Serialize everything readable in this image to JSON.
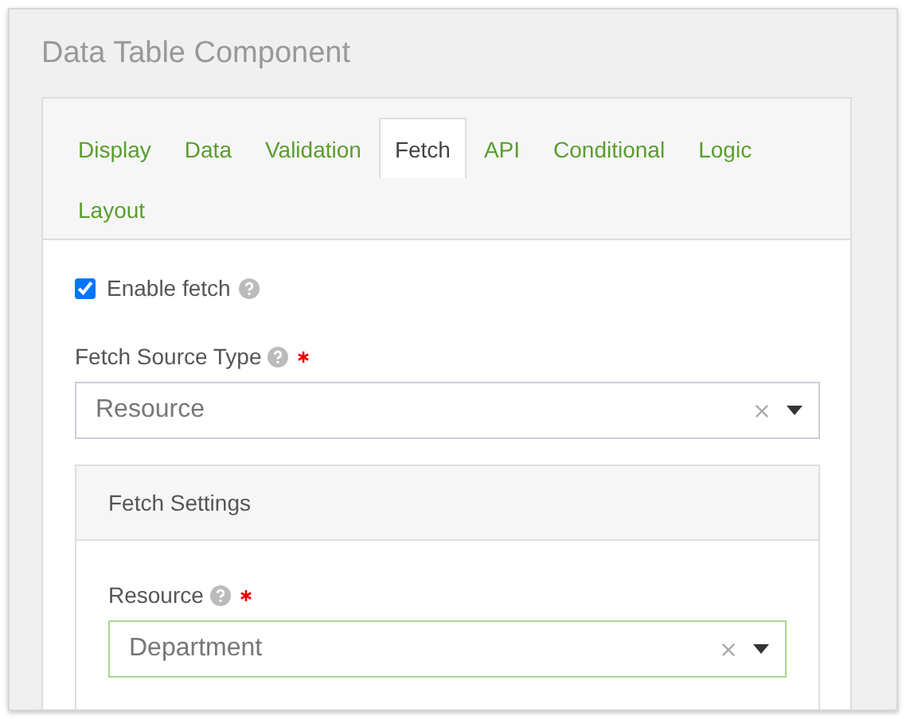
{
  "dialog": {
    "title": "Data Table Component"
  },
  "tabs": [
    {
      "label": "Display",
      "selected": false
    },
    {
      "label": "Data",
      "selected": false
    },
    {
      "label": "Validation",
      "selected": false
    },
    {
      "label": "Fetch",
      "selected": true
    },
    {
      "label": "API",
      "selected": false
    },
    {
      "label": "Conditional",
      "selected": false
    },
    {
      "label": "Logic",
      "selected": false
    },
    {
      "label": "Layout",
      "selected": false
    }
  ],
  "enable_fetch": {
    "label": "Enable fetch",
    "checked": true
  },
  "fetch_source_type": {
    "label": "Fetch Source Type",
    "required": true,
    "value": "Resource",
    "focused": false
  },
  "fetch_settings": {
    "title": "Fetch Settings",
    "resource": {
      "label": "Resource",
      "required": true,
      "value": "Department",
      "focused": true
    }
  }
}
